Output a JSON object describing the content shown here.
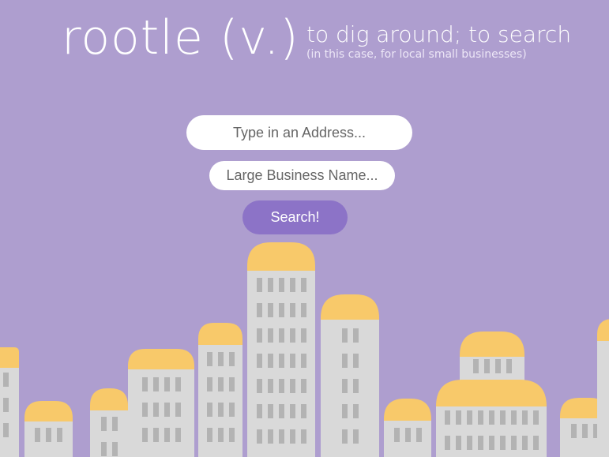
{
  "header": {
    "logo": "rootle (v.)",
    "definition": "to dig around; to search",
    "subdefinition": "(in this case, for local small businesses)"
  },
  "form": {
    "address_placeholder": "Type in an Address...",
    "business_placeholder": "Large Business Name...",
    "search_label": "Search!"
  },
  "colors": {
    "background": "#ae9ecf",
    "building": "#d9d9d9",
    "roof": "#f8c96a",
    "window": "#b3b3b3",
    "button": "#8c73c7"
  }
}
